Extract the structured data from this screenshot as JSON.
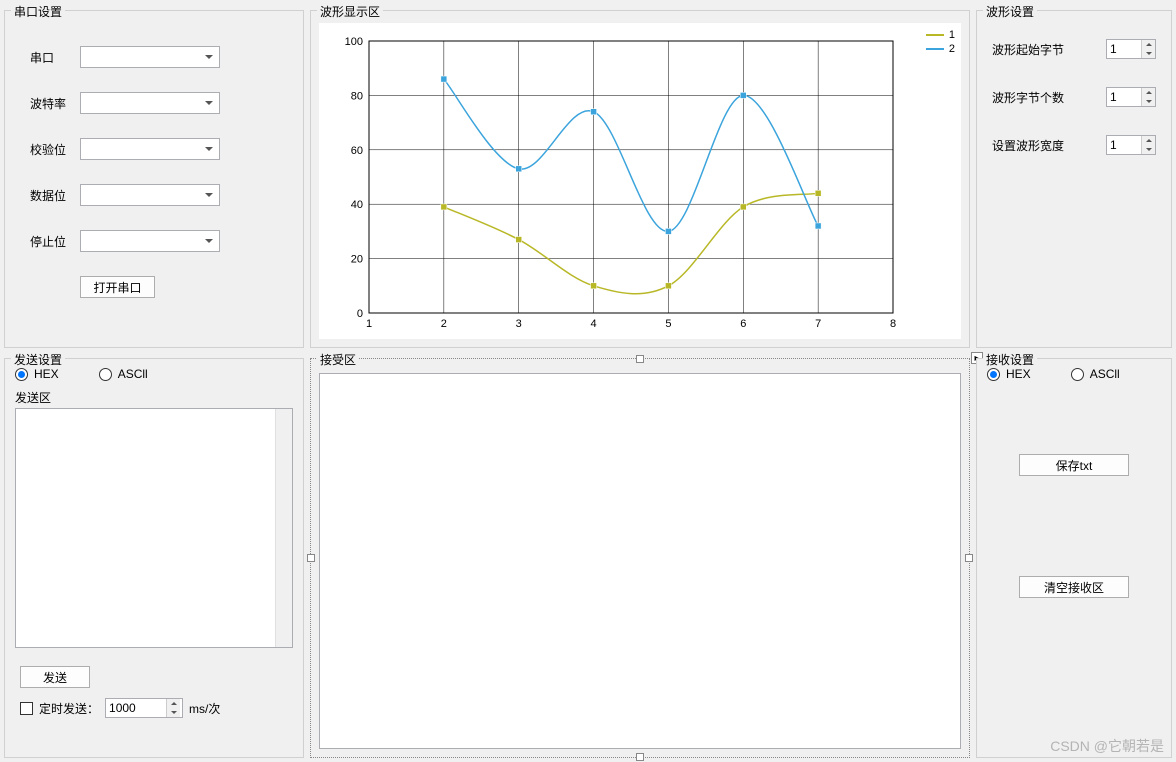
{
  "serial_panel": {
    "title": "串口设置",
    "port_label": "串口",
    "baud_label": "波特率",
    "parity_label": "校验位",
    "data_label": "数据位",
    "stop_label": "停止位",
    "open_btn": "打开串口"
  },
  "wave_display": {
    "title": "波形显示区"
  },
  "wave_settings": {
    "title": "波形设置",
    "start_byte_label": "波形起始字节",
    "byte_count_label": "波形字节个数",
    "width_label": "设置波形宽度",
    "start_byte_val": "1",
    "byte_count_val": "1",
    "width_val": "1"
  },
  "send_settings": {
    "title": "发送设置",
    "hex_label": "HEX",
    "ascii_label": "ASCll",
    "send_area_title": "发送区",
    "send_btn": "发送",
    "timer_label": "定时发送：",
    "timer_val": "1000",
    "timer_unit": "ms/次"
  },
  "recv_area": {
    "title": "接受区"
  },
  "recv_settings": {
    "title": "接收设置",
    "hex_label": "HEX",
    "ascii_label": "ASCll",
    "save_btn": "保存txt",
    "clear_btn": "清空接收区"
  },
  "watermark": "CSDN @它朝若是",
  "chart_data": {
    "type": "line",
    "x": [
      2,
      3,
      4,
      5,
      6,
      7
    ],
    "series": [
      {
        "name": "1",
        "color": "#b8b827",
        "values": [
          39,
          27,
          10,
          10,
          39,
          44
        ]
      },
      {
        "name": "2",
        "color": "#3ba4dc",
        "values": [
          86,
          53,
          74,
          30,
          80,
          32
        ]
      }
    ],
    "xlim": [
      1,
      8
    ],
    "ylim": [
      0,
      100
    ],
    "xticks": [
      1,
      2,
      3,
      4,
      5,
      6,
      7,
      8
    ],
    "yticks": [
      0,
      20,
      40,
      60,
      80,
      100
    ]
  }
}
